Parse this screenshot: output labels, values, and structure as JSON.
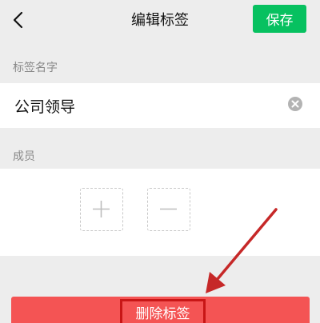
{
  "header": {
    "title": "编辑标签",
    "save_label": "保存",
    "back_icon": "chevron-left-icon"
  },
  "tag_name": {
    "section_label": "标签名字",
    "value": "公司领导",
    "clear_icon": "clear-circle-icon"
  },
  "members": {
    "section_label": "成员",
    "add_icon": "plus-icon",
    "remove_icon": "minus-icon"
  },
  "actions": {
    "delete_label": "删除标签"
  },
  "colors": {
    "accent_green": "#07c160",
    "danger_red": "#f45454",
    "highlight_red": "#c81616",
    "annotation_arrow": "#c62828"
  }
}
